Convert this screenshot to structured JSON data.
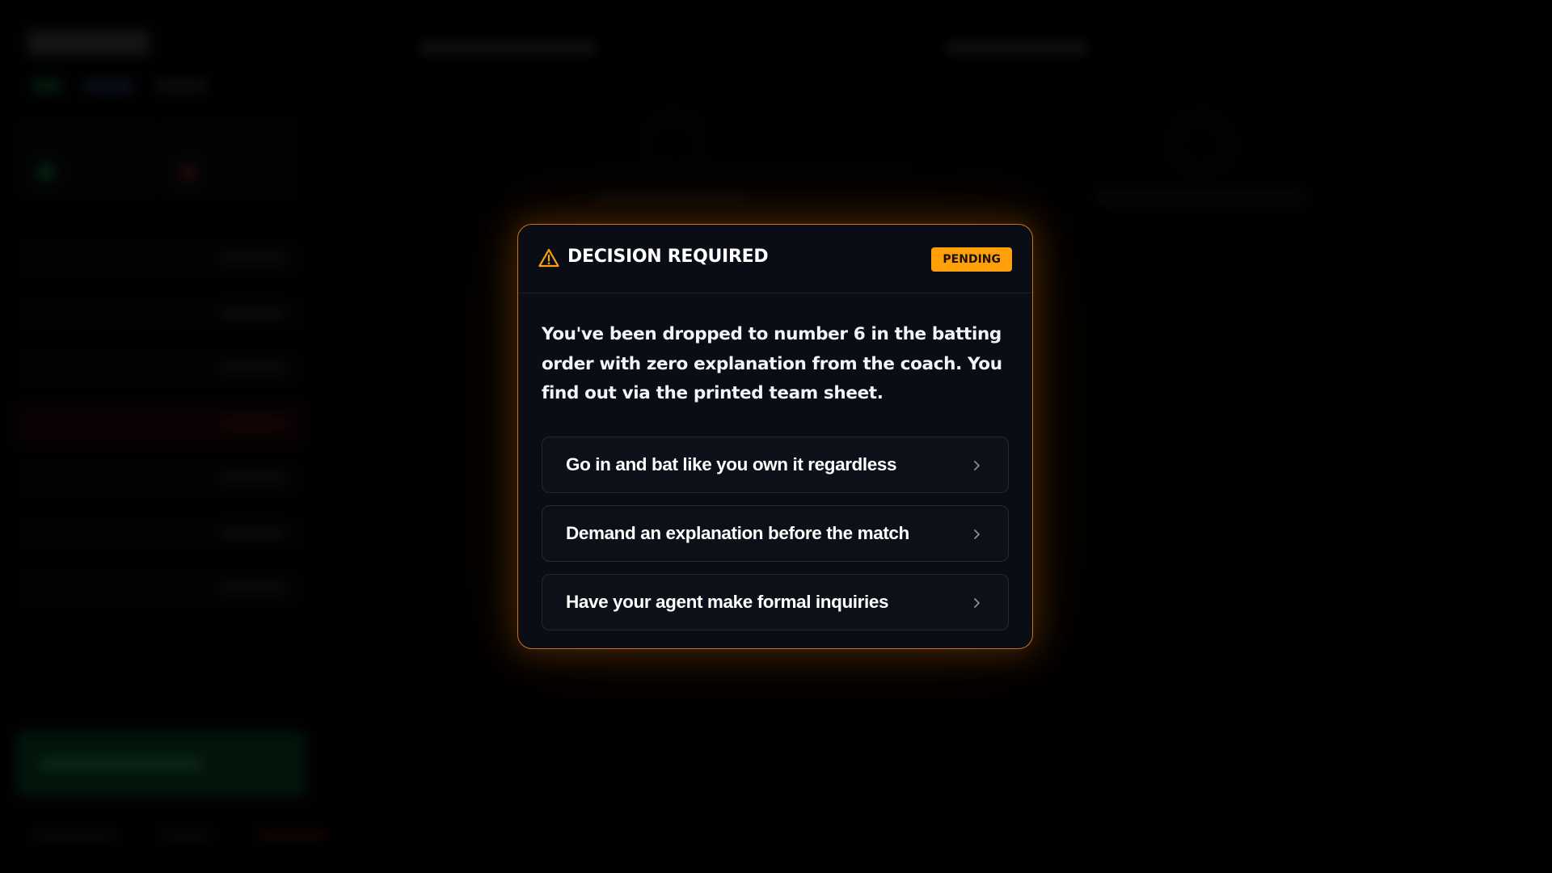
{
  "modal": {
    "title": "DECISION REQUIRED",
    "status_badge": "PENDING",
    "prompt": "You've been dropped to number 6 in the batting order with zero explanation from the coach. You find out via the printed team sheet.",
    "warning_icon": "warning-triangle-icon",
    "chevron_icon": "chevron-right-icon",
    "options": [
      {
        "label": "Go in and bat like you own it regardless"
      },
      {
        "label": "Demand an explanation before the match"
      },
      {
        "label": "Have your agent make formal inquiries"
      }
    ]
  },
  "colors": {
    "accent": "#ff9f0a",
    "modal_border": "#c77414",
    "modal_background": "#0a0d16",
    "option_border": "#252a36",
    "text": "#ffffff"
  }
}
